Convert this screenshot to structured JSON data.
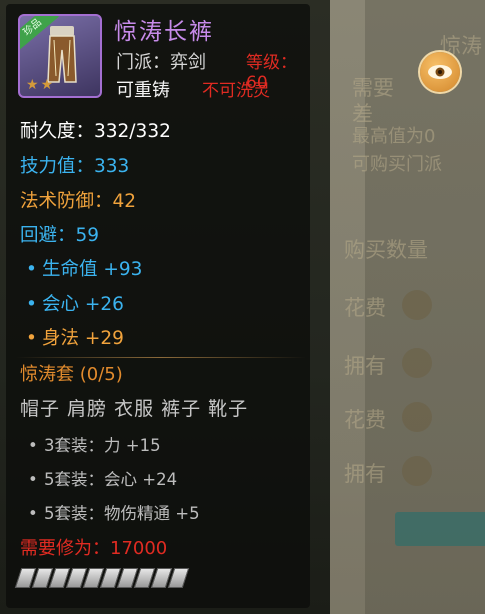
{
  "item": {
    "name": "惊涛长裤",
    "badge": "珍品",
    "sect": "门派：弈剑",
    "level_req": "等级：60",
    "reforge": "可重铸",
    "bind_status": "不可洗灵",
    "stars": 2
  },
  "stats": {
    "durability": "耐久度：332/332",
    "skill": "技力值：333",
    "magic_def": "法术防御：42",
    "dodge": "回避：59"
  },
  "extras": [
    {
      "label": "生命值",
      "value": "+93",
      "color": "#3bb3ef"
    },
    {
      "label": "会心",
      "value": "+26",
      "color": "#3bb3ef"
    },
    {
      "label": "身法",
      "value": "+29",
      "color": "#f1a33c"
    }
  ],
  "set": {
    "title": "惊涛套 (0/5)",
    "parts": "帽子 肩膀 衣服 裤子 靴子",
    "bonuses": [
      "3套装：力 +15",
      "5套装：会心 +24",
      "5套装：物伤精通 +5"
    ]
  },
  "requirement": "需要修为：17000",
  "durability_segments": 10,
  "background_text": [
    "惊涛",
    "需要",
    "差",
    "最高值为0",
    "可购买门派",
    "购买数量",
    "花费",
    "拥有",
    "花费",
    "拥有"
  ],
  "icons": {
    "eye": "eye-icon"
  }
}
